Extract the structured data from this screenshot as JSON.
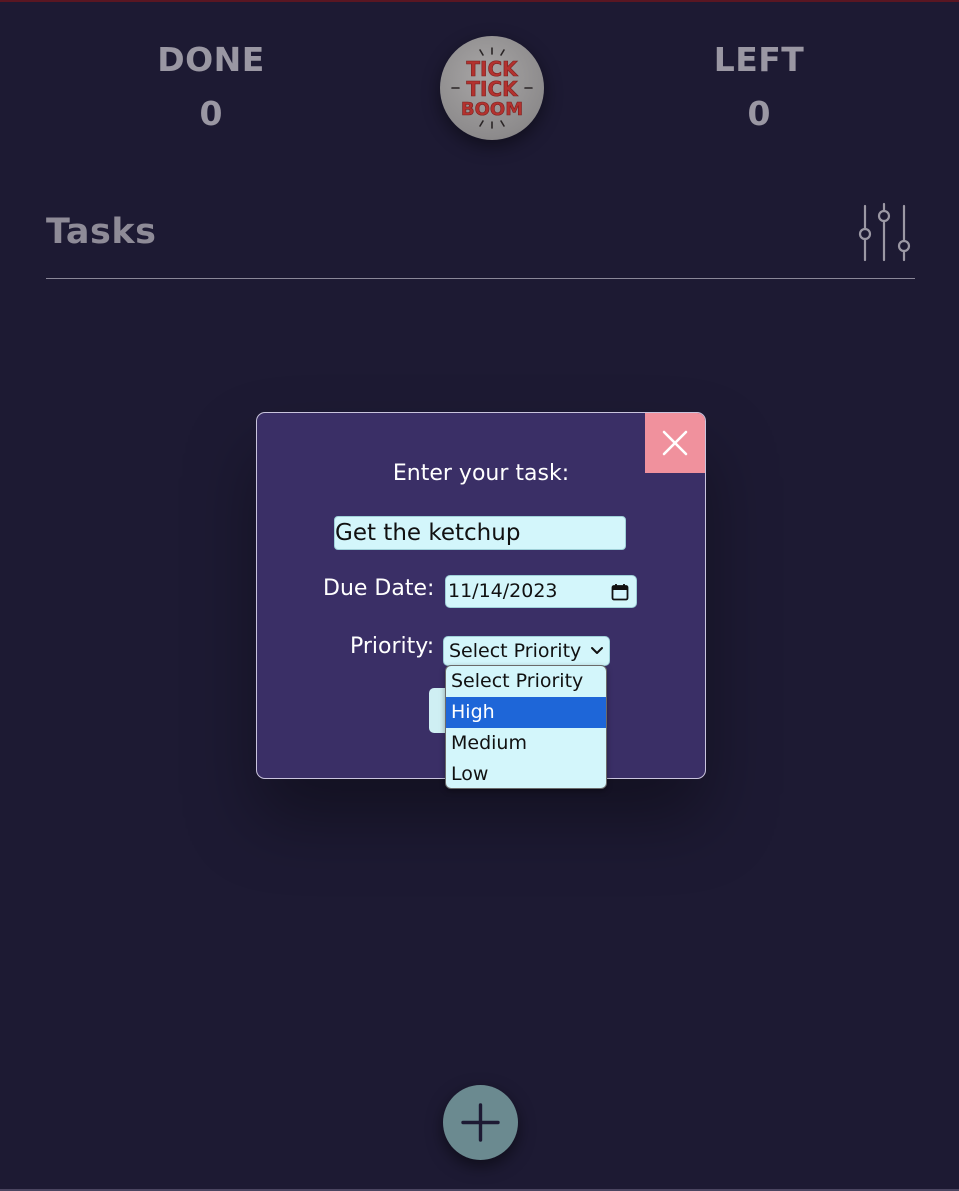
{
  "header": {
    "done_label": "DONE",
    "done_count": "0",
    "left_label": "LEFT",
    "left_count": "0",
    "logo_lines": [
      "TICK",
      "TICK",
      "BOOM"
    ]
  },
  "tasks": {
    "title": "Tasks",
    "filter_icon": "sliders-icon"
  },
  "modal": {
    "task_label": "Enter your task:",
    "task_value": "Get the ketchup",
    "due_label": "Due Date:",
    "due_value": "11/14/2023",
    "priority_label": "Priority:",
    "priority_selected": "Select Priority",
    "priority_options": [
      "Select Priority",
      "High",
      "Medium",
      "Low"
    ],
    "highlighted_option": "High",
    "close_icon": "close-icon",
    "calendar_icon": "calendar-icon"
  },
  "fab": {
    "icon": "plus-icon"
  },
  "colors": {
    "background": "#1d1a33",
    "modal_bg": "#3a2f66",
    "close_bg": "#f0919d",
    "input_bg": "#d3f6fb",
    "highlight": "#1e66d8",
    "logo_text": "#b3322f",
    "fab_bg": "#6b8a90"
  }
}
